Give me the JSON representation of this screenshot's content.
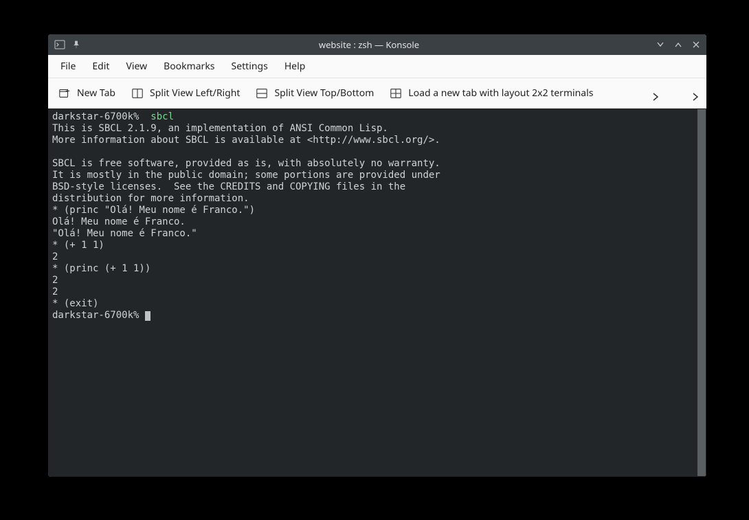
{
  "window": {
    "title": "website : zsh — Konsole"
  },
  "menubar": {
    "items": [
      "File",
      "Edit",
      "View",
      "Bookmarks",
      "Settings",
      "Help"
    ]
  },
  "toolbar": {
    "new_tab": "New Tab",
    "split_lr": "Split View Left/Right",
    "split_tb": "Split View Top/Bottom",
    "load_layout": "Load a new tab with layout 2x2 terminals"
  },
  "terminal": {
    "prompt1": "darkstar-6700k%",
    "cmd1": "  sbcl",
    "lines": [
      "This is SBCL 2.1.9, an implementation of ANSI Common Lisp.",
      "More information about SBCL is available at <http://www.sbcl.org/>.",
      "",
      "SBCL is free software, provided as is, with absolutely no warranty.",
      "It is mostly in the public domain; some portions are provided under",
      "BSD-style licenses.  See the CREDITS and COPYING files in the",
      "distribution for more information.",
      "* (princ \"Olá! Meu nome é Franco.\")",
      "Olá! Meu nome é Franco.",
      "\"Olá! Meu nome é Franco.\"",
      "* (+ 1 1)",
      "2",
      "* (princ (+ 1 1))",
      "2",
      "2",
      "* (exit)"
    ],
    "prompt2": "darkstar-6700k% "
  }
}
